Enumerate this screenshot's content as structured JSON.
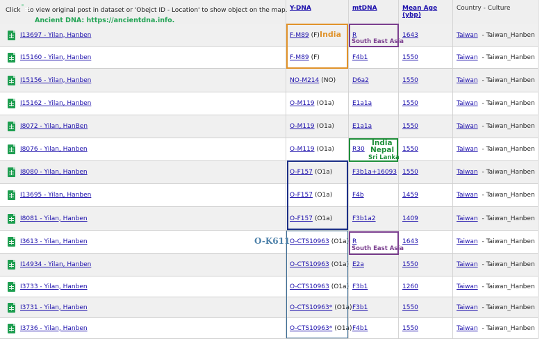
{
  "header": {
    "click_prefix": "Click",
    "click_suffix": "to view original post in dataset or 'Obejct ID - Location' to show object on the map.",
    "ancient_dna": "Ancient DNA: https://ancientdna.info.",
    "columns": [
      "Y-DNA",
      "mtDNA",
      "Mean Age (ybp)",
      "Country - Culture"
    ]
  },
  "rows": [
    {
      "object": "I13697 - Yilan, Hanben",
      "ydna": "F-M89",
      "yhap": "(F)",
      "mtdna": "R",
      "age": "1643",
      "country": "Taiwan",
      "culture": "Taiwan_Hanben"
    },
    {
      "object": "I15160 - Yilan, Hanben",
      "ydna": "F-M89",
      "yhap": "(F)",
      "mtdna": "F4b1",
      "age": "1550",
      "country": "Taiwan",
      "culture": "Taiwan_Hanben"
    },
    {
      "object": "I15156 - Yilan, Hanben",
      "ydna": "NO-M214",
      "yhap": "(NO)",
      "mtdna": "D6a2",
      "age": "1550",
      "country": "Taiwan",
      "culture": "Taiwan_Hanben"
    },
    {
      "object": "I15162 - Yilan, Hanben",
      "ydna": "O-M119",
      "yhap": "(O1a)",
      "mtdna": "E1a1a",
      "age": "1550",
      "country": "Taiwan",
      "culture": "Taiwan_Hanben"
    },
    {
      "object": "I8072 - Yilan, HanBen",
      "ydna": "O-M119",
      "yhap": "(O1a)",
      "mtdna": "E1a1a",
      "age": "1550",
      "country": "Taiwan",
      "culture": "Taiwan_Hanben"
    },
    {
      "object": "I8076 - Yilan, Hanben",
      "ydna": "O-M119",
      "yhap": "(O1a)",
      "mtdna": "R30",
      "age": "1550",
      "country": "Taiwan",
      "culture": "Taiwan_Hanben"
    },
    {
      "object": "I8080 - Yilan, Hanben",
      "ydna": "O-F157",
      "yhap": "(O1a)",
      "mtdna": "F3b1a+16093",
      "age": "1550",
      "country": "Taiwan",
      "culture": "Taiwan_Hanben"
    },
    {
      "object": "I13695 - Yilan, Hanben",
      "ydna": "O-F157",
      "yhap": "(O1a)",
      "mtdna": "F4b",
      "age": "1459",
      "country": "Taiwan",
      "culture": "Taiwan_Hanben"
    },
    {
      "object": "I8081 - Yilan, Hanben",
      "ydna": "O-F157",
      "yhap": "(O1a)",
      "mtdna": "F3b1a2",
      "age": "1409",
      "country": "Taiwan",
      "culture": "Taiwan_Hanben"
    },
    {
      "object": "I3613 - Yilan, Hanben",
      "ydna": "O-CTS10963",
      "yhap": "(O1a)",
      "mtdna": "R",
      "age": "1643",
      "country": "Taiwan",
      "culture": "Taiwan_Hanben"
    },
    {
      "object": "I14934 - Yilan, Hanben",
      "ydna": "O-CTS10963",
      "yhap": "(O1a)",
      "mtdna": "E2a",
      "age": "1550",
      "country": "Taiwan",
      "culture": "Taiwan_Hanben"
    },
    {
      "object": "I3733 - Yilan, Hanben",
      "ydna": "O-CTS10963",
      "yhap": "(O1a)",
      "mtdna": "F3b1",
      "age": "1260",
      "country": "Taiwan",
      "culture": "Taiwan_Hanben"
    },
    {
      "object": "I3731 - Yilan, Hanben",
      "ydna": "O-CTS10963*",
      "yhap": "(O1a)",
      "mtdna": "F3b1",
      "age": "1550",
      "country": "Taiwan",
      "culture": "Taiwan_Hanben"
    },
    {
      "object": "I3736 - Yilan, Hanben",
      "ydna": "O-CTS10963*",
      "yhap": "(O1a)",
      "mtdna": "F4b1",
      "age": "1550",
      "country": "Taiwan",
      "culture": "Taiwan_Hanben"
    }
  ],
  "annotations": {
    "india": "India",
    "south_east_asia_1": "South East Asia",
    "south_east_asia_2": "South East Asia",
    "india_2": "India",
    "nepal": "Nepal",
    "sri_lanka": "Sri Lanka",
    "o_k611": "O-K611"
  },
  "colors": {
    "orange": "#e0922a",
    "purple": "#7b3f8f",
    "green": "#1f8f3a",
    "navy": "#1c2f86",
    "steel": "#3f6f96",
    "sheet_icon": "#1e9e50",
    "link": "#1a0dab"
  },
  "icons": {
    "row_icon": "google-sheets-icon"
  }
}
